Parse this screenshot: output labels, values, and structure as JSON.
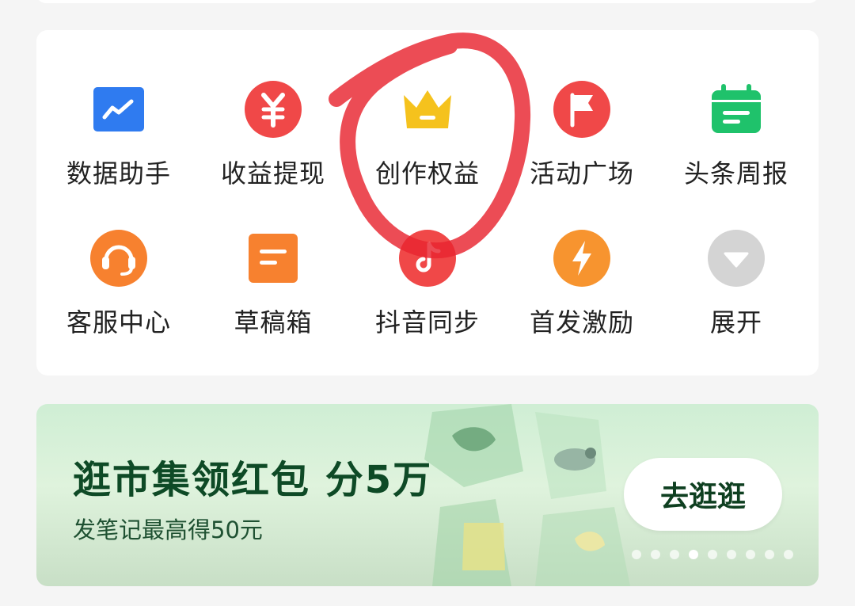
{
  "grid": {
    "items": [
      {
        "label": "数据助手",
        "icon": "chart-trend-icon",
        "color": "#2f7bf0"
      },
      {
        "label": "收益提现",
        "icon": "yen-icon",
        "color": "#f04848"
      },
      {
        "label": "创作权益",
        "icon": "crown-icon",
        "color": "#f5c21d"
      },
      {
        "label": "活动广场",
        "icon": "flag-icon",
        "color": "#f04848"
      },
      {
        "label": "头条周报",
        "icon": "calendar-icon",
        "color": "#1fc26b"
      },
      {
        "label": "客服中心",
        "icon": "headset-icon",
        "color": "#f7812f"
      },
      {
        "label": "草稿箱",
        "icon": "draft-icon",
        "color": "#f7812f"
      },
      {
        "label": "抖音同步",
        "icon": "douyin-icon",
        "color": "#f04848"
      },
      {
        "label": "首发激励",
        "icon": "lightning-icon",
        "color": "#f7942f"
      },
      {
        "label": "展开",
        "icon": "expand-down-icon",
        "color": "#d4d4d4"
      }
    ]
  },
  "annotation": {
    "color": "#e8242f"
  },
  "banner": {
    "title": "逛市集领红包 分5万",
    "subtitle": "发笔记最高得50元",
    "button_label": "去逛逛",
    "slides_total": 9,
    "active_slide": 4,
    "accent": "#0e4a26"
  }
}
